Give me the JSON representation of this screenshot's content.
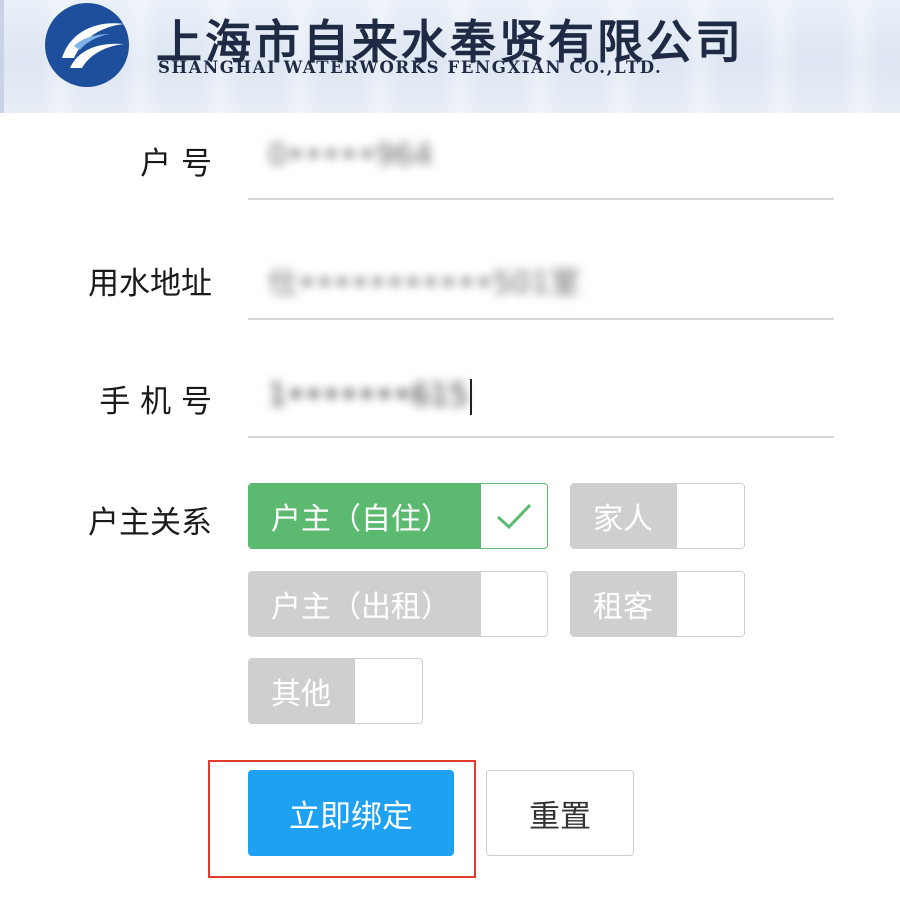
{
  "header": {
    "company_cn": "上海市自来水奉贤有限公司",
    "company_en": "SHANGHAI WATERWORKS FENGXIAN CO.,LTD."
  },
  "form": {
    "account": {
      "label": "户 号",
      "value": "0•••••964"
    },
    "address": {
      "label": "用水地址",
      "value": "仕•••••••••••501室"
    },
    "phone": {
      "label": "手 机 号",
      "value": "1•••••••615"
    },
    "relation": {
      "label": "户主关系",
      "options": [
        {
          "label": "户主（自住）",
          "selected": true
        },
        {
          "label": "家人",
          "selected": false
        },
        {
          "label": "户主（出租）",
          "selected": false
        },
        {
          "label": "租客",
          "selected": false
        },
        {
          "label": "其他",
          "selected": false
        }
      ]
    }
  },
  "buttons": {
    "bind": "立即绑定",
    "reset": "重置"
  },
  "colors": {
    "selected_green": "#5bba6f",
    "primary_blue": "#1ea1f2",
    "highlight_red": "#e23b2e"
  }
}
